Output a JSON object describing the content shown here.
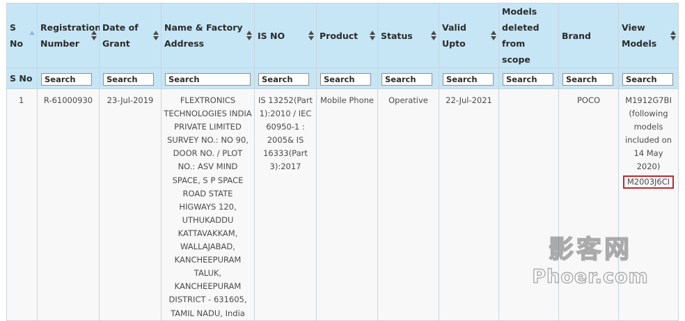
{
  "table": {
    "headers": [
      {
        "key": "sno",
        "label": "S No",
        "sort": "asc"
      },
      {
        "key": "reg",
        "label": "Registration Number",
        "sort": "both"
      },
      {
        "key": "date",
        "label": "Date of Grant",
        "sort": "both"
      },
      {
        "key": "name",
        "label": "Name & Factory Address",
        "sort": "both"
      },
      {
        "key": "isno",
        "label": "IS NO",
        "sort": "both"
      },
      {
        "key": "product",
        "label": "Product",
        "sort": "both"
      },
      {
        "key": "status",
        "label": "Status",
        "sort": "both"
      },
      {
        "key": "valid",
        "label": "Valid Upto",
        "sort": "both"
      },
      {
        "key": "deleted",
        "label": "Models deleted from scope",
        "sort": "none"
      },
      {
        "key": "brand",
        "label": "Brand",
        "sort": "none"
      },
      {
        "key": "view",
        "label": "View Models",
        "sort": "both"
      }
    ],
    "filter_row_label": "S No",
    "search_placeholder": "Search",
    "rows": [
      {
        "sno": "1",
        "reg": "R-61000930",
        "date": "23-Jul-2019",
        "name": "FLEXTRONICS TECHNOLOGIES INDIA PRIVATE LIMITED SURVEY NO.: NO 90, DOOR NO. / PLOT NO.: ASV MIND SPACE, S P SPACE ROAD STATE HIGWAYS 120, UTHUKADDU KATTAVAKKAM, WALLAJABAD, KANCHEEPURAM TALUK, KANCHEEPURAM DISTRICT - 631605, TAMIL NADU, India",
        "isno": "IS 13252(Part 1):2010 / IEC 60950-1 : 2005& IS 16333(Part 3):2017",
        "product": "Mobile Phone",
        "status": "Operative",
        "valid": "22-Jul-2021",
        "deleted": "",
        "brand": "POCO",
        "view": "M1912G7BI (following models included on 14 May 2020)",
        "view_highlight": "M2003J6CI"
      }
    ]
  },
  "watermark": {
    "chinese": "影客网",
    "latin": "Phoer.com"
  },
  "colors": {
    "header_bg": "#c6e6f6",
    "row_bg": "#f8f8f8",
    "highlight_border": "#c0272d",
    "border": "#c9d3dc"
  }
}
